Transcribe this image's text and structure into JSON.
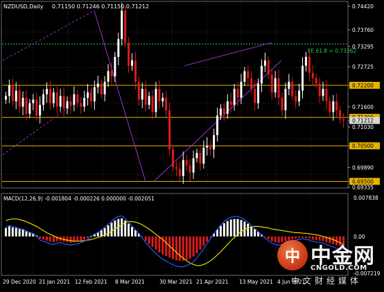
{
  "header": {
    "symbol": "NZDUSD,Daily",
    "ohlc": "0.71150 0.71246 0.71150 0.71212"
  },
  "fib_label": "FE 61.8 = 0.73362",
  "macd_header": "MACD(12,26,9) -0.001804 -0.000226 0.000000 -0.002051",
  "watermark": {
    "logo_char": "中",
    "title": "中金网",
    "url": "CNGOLD.COM",
    "subtitle": "中文财经媒体"
  },
  "colors": {
    "background": "#000000",
    "grid_line": "#3a3a3a",
    "bull_candle": "#ffffff",
    "bear_candle": "#e01b1b",
    "support_line": "#e8b300",
    "channel_line": "#9a34d8",
    "fib_line": "#2fc44a",
    "macd_signal": "#e6d800",
    "macd_main": "#1f5bff"
  },
  "chart_data": [
    {
      "type": "candlestick",
      "title": "NZDUSD,Daily",
      "ylim": [
        0.69335,
        0.74442
      ],
      "y_ticks": [
        "0.74420",
        "0.73760",
        "0.73295",
        "0.72725",
        "0.72200",
        "0.71600",
        "0.71300",
        "0.71212",
        "0.71030",
        "0.70500",
        "0.69890",
        "0.69500",
        "0.69335"
      ],
      "highlighted_levels": [
        "0.72200",
        "0.71300",
        "0.70500",
        "0.69500"
      ],
      "current_price": "0.71212",
      "x_ticks": [
        "29 Dec 2020",
        "21 Jan 2021",
        "12 Feb 2021",
        "8 Mar 2021",
        "30 Mar 2021",
        "21 Apr 2021",
        "13 May 2021",
        "4 Jun 2021"
      ],
      "horizontal_levels": [
        0.722,
        0.713,
        0.705,
        0.695
      ],
      "fib_level": 0.73362,
      "closes": [
        0.719,
        0.722,
        0.7175,
        0.7205,
        0.716,
        0.7185,
        0.714,
        0.717,
        0.718,
        0.7135,
        0.7165,
        0.7195,
        0.721,
        0.717,
        0.72,
        0.716,
        0.719,
        0.7155,
        0.7175,
        0.7165,
        0.7195,
        0.717,
        0.716,
        0.7185,
        0.72,
        0.7175,
        0.7215,
        0.7225,
        0.7195,
        0.723,
        0.726,
        0.7245,
        0.73,
        0.735,
        0.743,
        0.734,
        0.7275,
        0.729,
        0.723,
        0.718,
        0.721,
        0.7165,
        0.719,
        0.7145,
        0.721,
        0.7175,
        0.7185,
        0.715,
        0.704,
        0.699,
        0.6985,
        0.6965,
        0.701,
        0.6995,
        0.6975,
        0.7015,
        0.703,
        0.7,
        0.7045,
        0.705,
        0.704,
        0.708,
        0.7135,
        0.7155,
        0.714,
        0.7175,
        0.7165,
        0.721,
        0.7185,
        0.723,
        0.726,
        0.724,
        0.721,
        0.717,
        0.7225,
        0.7275,
        0.729,
        0.725,
        0.72,
        0.724,
        0.7185,
        0.715,
        0.721,
        0.723,
        0.719,
        0.7175,
        0.7205,
        0.7275,
        0.73,
        0.7255,
        0.724,
        0.7225,
        0.719,
        0.721,
        0.7175,
        0.7145,
        0.7175,
        0.715,
        0.7125,
        0.7121
      ]
    },
    {
      "type": "bar",
      "title": "MACD(12,26,9)",
      "values_text": "-0.001804 -0.000226 0.000000 -0.002051",
      "y_ticks": [
        "0.007838",
        "0.00",
        "-0.007219"
      ],
      "ylim": [
        -0.007219,
        0.007838
      ],
      "series": [
        {
          "name": "MACD",
          "style": "histogram"
        },
        {
          "name": "Signal",
          "style": "line"
        }
      ],
      "histogram": [
        0.0016,
        0.0019,
        0.0017,
        0.0016,
        0.0014,
        0.0013,
        0.001,
        0.0008,
        0.0006,
        0.0002,
        -0.0004,
        -0.0006,
        -0.0008,
        -0.001,
        -0.0011,
        -0.0009,
        -0.0008,
        -0.001,
        -0.0011,
        -0.0012,
        -0.0011,
        -0.001,
        -0.0008,
        -0.0006,
        -0.0003,
        0.0001,
        0.0005,
        0.0008,
        0.0012,
        0.0016,
        0.0021,
        0.0026,
        0.003,
        0.0033,
        0.0034,
        0.003,
        0.0024,
        0.0018,
        0.0012,
        0.0006,
        -0.0001,
        -0.0008,
        -0.0014,
        -0.002,
        -0.0025,
        -0.003,
        -0.0034,
        -0.0037,
        -0.004,
        -0.0043,
        -0.0045,
        -0.0046,
        -0.0046,
        -0.0044,
        -0.0042,
        -0.0038,
        -0.0032,
        -0.0025,
        -0.0018,
        -0.001,
        -0.0002,
        0.0006,
        0.0013,
        0.002,
        0.0025,
        0.0029,
        0.0032,
        0.0033,
        0.0033,
        0.0031,
        0.0028,
        0.0024,
        0.0019,
        0.0014,
        0.0009,
        0.0004,
        -0.0001,
        -0.0005,
        -0.0009,
        -0.0011,
        -0.0012,
        -0.0011,
        -0.0009,
        -0.0007,
        -0.0005,
        -0.0004,
        -0.0003,
        -0.0002,
        -0.0003,
        -0.0004,
        -0.0006,
        -0.0007,
        -0.0008,
        -0.0009,
        -0.0011,
        -0.0013,
        -0.0015,
        -0.0017,
        -0.0018,
        -0.0018
      ],
      "signal": [
        0.003,
        0.0032,
        0.0033,
        0.0033,
        0.0032,
        0.003,
        0.0028,
        0.0025,
        0.0022,
        0.0019,
        0.0015,
        0.0011,
        0.0007,
        0.0004,
        0.0001,
        -0.0002,
        -0.0004,
        -0.0006,
        -0.0007,
        -0.0008,
        -0.0009,
        -0.0009,
        -0.0009,
        -0.0008,
        -0.0007,
        -0.0006,
        -0.0004,
        -0.0002,
        0.0,
        0.0003,
        0.0006,
        0.001,
        0.0014,
        0.0018,
        0.0022,
        0.0026,
        0.0028,
        0.0028,
        0.0027,
        0.0025,
        0.0022,
        0.0018,
        0.0014,
        0.0009,
        0.0004,
        -0.0001,
        -0.0006,
        -0.0012,
        -0.0018,
        -0.0024,
        -0.003,
        -0.0036,
        -0.0041,
        -0.0046,
        -0.005,
        -0.0053,
        -0.0055,
        -0.0055,
        -0.0053,
        -0.005,
        -0.0046,
        -0.0041,
        -0.0035,
        -0.0029,
        -0.0022,
        -0.0015,
        -0.0008,
        -0.0002,
        0.0004,
        0.0009,
        0.0013,
        0.0016,
        0.0018,
        0.0019,
        0.0019,
        0.0018,
        0.0017,
        0.0016,
        0.0014,
        0.0013,
        0.0012,
        0.0011,
        0.001,
        0.0009,
        0.0008,
        0.0007,
        0.0007,
        0.0006,
        0.0006,
        0.0005,
        0.0004,
        0.0003,
        0.0002,
        0.0,
        -0.0002,
        -0.0004,
        -0.0006,
        -0.0009,
        -0.0012,
        -0.0015
      ]
    }
  ]
}
